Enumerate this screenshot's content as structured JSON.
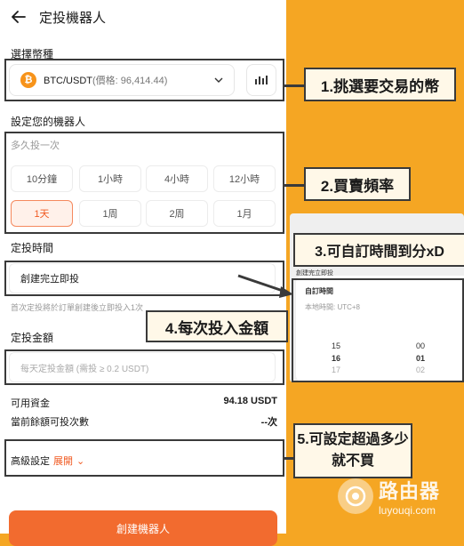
{
  "header": {
    "title": "定投機器人"
  },
  "pair_section": {
    "label": "選擇幣種",
    "pair": "BTC/USDT",
    "price_text": "(價格: 96,414.44)"
  },
  "bot_section": {
    "label": "設定您的機器人",
    "frequency_label": "多久投一次",
    "options": [
      "10分鐘",
      "1小時",
      "4小時",
      "12小時",
      "1天",
      "1周",
      "2周",
      "1月"
    ],
    "selected": "1天"
  },
  "timing": {
    "label": "定投時間",
    "value": "創建完立即投",
    "hint": "首次定投將於訂單創建後立即投入1次"
  },
  "amount": {
    "label": "定投金額",
    "placeholder": "每天定投金額 (需投 ≥ 0.2 USDT)"
  },
  "funds": {
    "available_label": "可用資金",
    "available_value": "94.18 USDT",
    "times_label": "當前餘額可投次數",
    "times_value": "--次"
  },
  "advanced": {
    "label": "高級設定",
    "expand": "展開"
  },
  "create_button": "創建機器人",
  "annotations": {
    "a1": "1.挑選要交易的幣",
    "a2": "2.買賣頻率",
    "a3": "3.可自訂時間到分xD",
    "a4": "4.每次投入金額",
    "a5": "5.可設定超過多少就不買"
  },
  "inset": {
    "field": "創建完立即投",
    "title": "自訂時間",
    "timezone": "本地時間: UTC+8",
    "hours": [
      "15",
      "16",
      "17"
    ],
    "minutes": [
      "00",
      "01",
      "02"
    ]
  },
  "watermark": {
    "name": "路由器",
    "url": "luyouqi.com"
  },
  "colors": {
    "accent": "#f26b2f",
    "background": "#f5a623",
    "btc": "#f7931a"
  }
}
